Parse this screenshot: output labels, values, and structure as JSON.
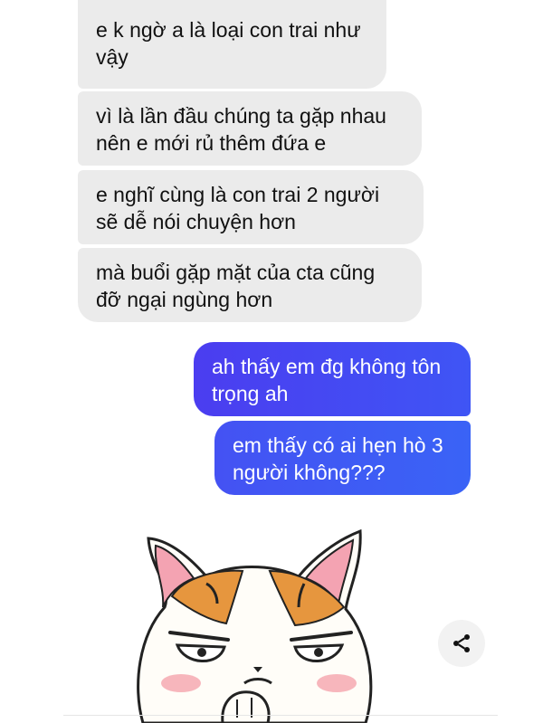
{
  "messages": [
    {
      "side": "incoming",
      "text": "e k ngờ a là loại con trai như\nvậy"
    },
    {
      "side": "incoming",
      "text": "vì là lần đầu chúng ta gặp nhau\nnên e mới rủ thêm đứa e"
    },
    {
      "side": "incoming",
      "text": "e nghĩ cùng là con trai 2 người\nsẽ dễ nói chuyện hơn"
    },
    {
      "side": "incoming",
      "text": "mà buổi gặp mặt của cta cũng\nđỡ ngại ngùng hơn"
    },
    {
      "side": "outgoing",
      "text": "ah thấy em đg không tôn\ntrọng ah"
    },
    {
      "side": "outgoing",
      "text": "em thấy có ai hẹn hò 3\nngười không???"
    }
  ],
  "sticker": {
    "icon": "angry-cat-sticker"
  },
  "share": {
    "icon": "share-icon"
  },
  "colors": {
    "incoming_bubble": "#ebebeb",
    "outgoing_bubble": "#4b3df0",
    "text": "#111111"
  }
}
